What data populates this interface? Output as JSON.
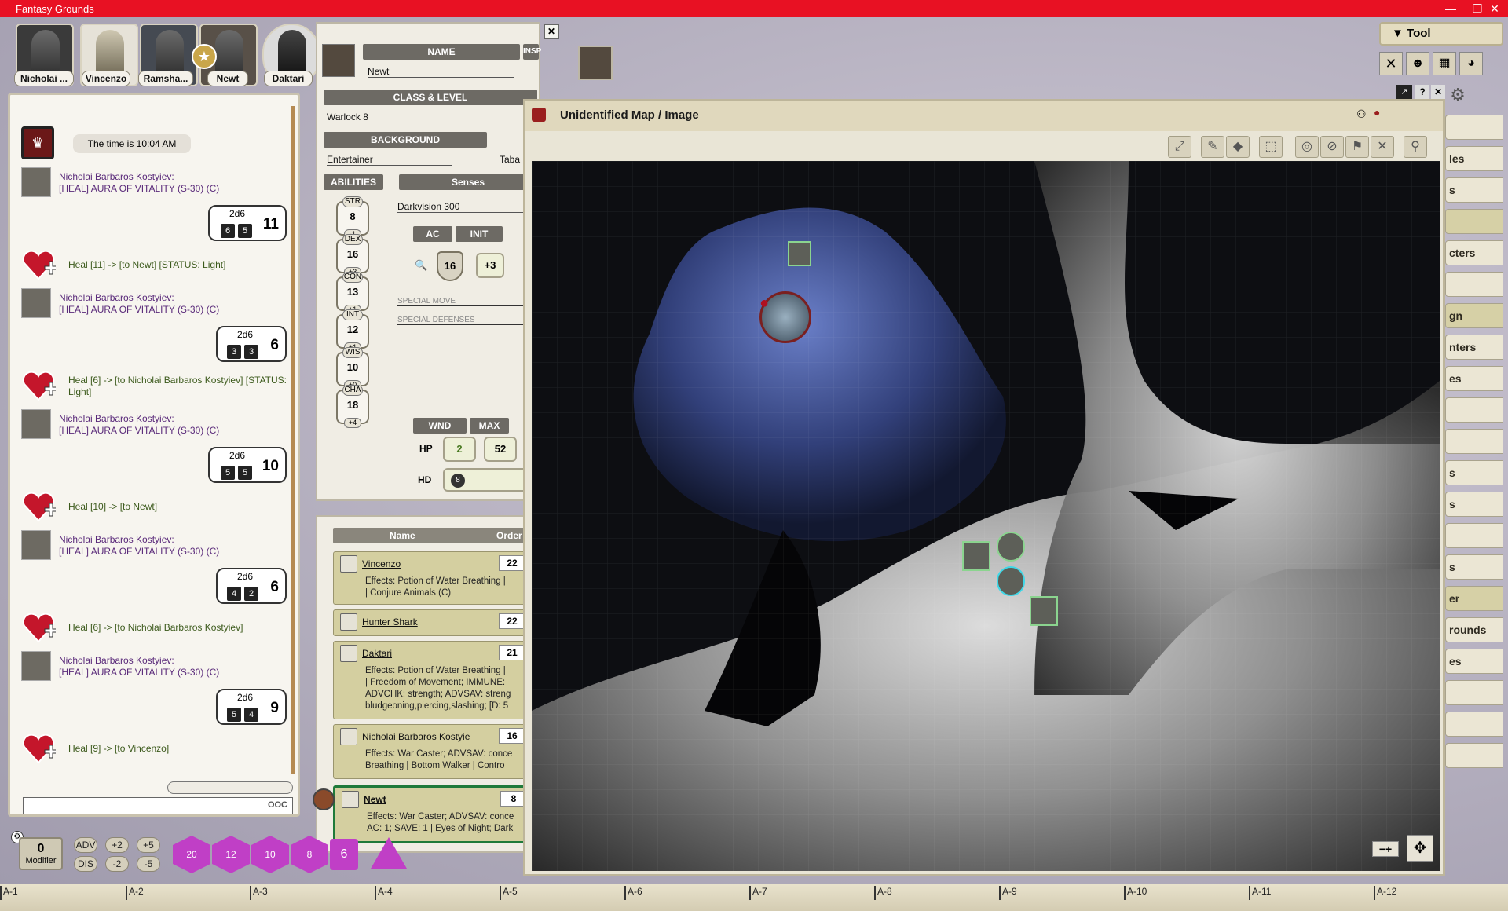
{
  "window": {
    "title": "Fantasy Grounds",
    "min": "—",
    "max": "❐",
    "close": "✕"
  },
  "party": [
    {
      "name": "Nicholai ..."
    },
    {
      "name": "Vincenzo"
    },
    {
      "name": "Ramsha..."
    },
    {
      "name": "Newt"
    },
    {
      "name": "Daktari"
    }
  ],
  "chat": {
    "time": "The time is 10:04 AM",
    "actor": "Nicholai Barbaros Kostyiev:",
    "spell": "[HEAL] AURA OF VITALITY (S-30) (C)",
    "rolls": [
      {
        "dice_label": "2d6",
        "d1": "6",
        "d2": "5",
        "total": "11",
        "heal": "Heal [11] -> [to Newt] [STATUS: Light]"
      },
      {
        "dice_label": "2d6",
        "d1": "3",
        "d2": "3",
        "total": "6",
        "heal": "Heal [6] -> [to Nicholai Barbaros Kostyiev] [STATUS: Light]"
      },
      {
        "dice_label": "2d6",
        "d1": "5",
        "d2": "5",
        "total": "10",
        "heal": "Heal [10] -> [to Newt]"
      },
      {
        "dice_label": "2d6",
        "d1": "4",
        "d2": "2",
        "total": "6",
        "heal": "Heal [6] -> [to Nicholai Barbaros Kostyiev]"
      },
      {
        "dice_label": "2d6",
        "d1": "5",
        "d2": "4",
        "total": "9",
        "heal": "Heal [9] -> [to Vincenzo]"
      }
    ],
    "input_mode": "OOC"
  },
  "sheet": {
    "name_header": "NAME",
    "insp_header": "INSP",
    "name": "Newt",
    "class_header": "CLASS & LEVEL",
    "class": "Warlock 8",
    "background_header": "BACKGROUND",
    "background": "Entertainer",
    "race": "Taba",
    "abilities_header": "ABILITIES",
    "senses_header": "Senses",
    "senses": "Darkvision 300",
    "abilities": [
      {
        "label": "STR",
        "score": "8",
        "mod": "-1"
      },
      {
        "label": "DEX",
        "score": "16",
        "mod": "+3"
      },
      {
        "label": "CON",
        "score": "13",
        "mod": "+1"
      },
      {
        "label": "INT",
        "score": "12",
        "mod": "+1"
      },
      {
        "label": "WIS",
        "score": "10",
        "mod": "+0"
      },
      {
        "label": "CHA",
        "score": "18",
        "mod": "+4"
      }
    ],
    "ac_header": "AC",
    "init_header": "INIT",
    "ac": "16",
    "init": "+3",
    "special_move": "SPECIAL MOVE",
    "special_defenses": "SPECIAL DEFENSES",
    "wnd_header": "WND",
    "max_header": "MAX",
    "hp_label": "HP",
    "hp_wnd": "2",
    "hp_max": "52",
    "hd_label": "HD",
    "hd_die": "8"
  },
  "tracker": {
    "col_name": "Name",
    "col_order": "Order",
    "rows": [
      {
        "name": "Vincenzo",
        "order": "22",
        "effects": "Effects: Potion of Water Breathing |\n| Conjure Animals (C)"
      },
      {
        "name": "Hunter Shark",
        "order": "22",
        "effects": ""
      },
      {
        "name": "Daktari",
        "order": "21",
        "effects": "Effects: Potion of Water Breathing |\n| Freedom of Movement; IMMUNE:\nADVCHK: strength; ADVSAV: streng\nbludgeoning,piercing,slashing; [D: 5"
      },
      {
        "name": "Nicholai Barbaros Kostyie",
        "order": "16",
        "effects": "Effects: War Caster; ADVSAV: conce\nBreathing | Bottom Walker | Contro"
      },
      {
        "name": "Newt",
        "order": "8",
        "effects": "Effects: War Caster; ADVSAV: conce\nAC: 1; SAVE: 1 | Eyes of Night; Dark"
      }
    ]
  },
  "map": {
    "title": "Unidentified Map / Image"
  },
  "sidebar": {
    "tool_label": "▼ Tool",
    "tabs": [
      "les",
      "s",
      "",
      "cters",
      "",
      "gn",
      "nters",
      "es",
      "",
      "",
      "s",
      "s",
      "",
      "s",
      "er",
      "rounds",
      "es",
      "",
      "",
      ""
    ]
  },
  "modifier": {
    "value": "0",
    "label": "Modifier"
  },
  "modbuttons": {
    "adv": "ADV",
    "dis": "DIS",
    "p2": "+2",
    "m2": "-2",
    "p5": "+5",
    "m5": "-5"
  },
  "dice": {
    "d20": "20",
    "d12": "12",
    "d10": "10",
    "d8": "8",
    "d6": "6"
  },
  "timeline": [
    "A-1",
    "A-2",
    "A-3",
    "A-4",
    "A-5",
    "A-6",
    "A-7",
    "A-8",
    "A-9",
    "A-10",
    "A-11",
    "A-12"
  ],
  "colors": {
    "title_red": "#e81123",
    "parchment": "#f0ede4",
    "header_gray": "#6d6a64",
    "dice_purple": "#c03fc6",
    "chat_purple": "#5a2a7a",
    "heal_green": "#3c5a1c"
  }
}
